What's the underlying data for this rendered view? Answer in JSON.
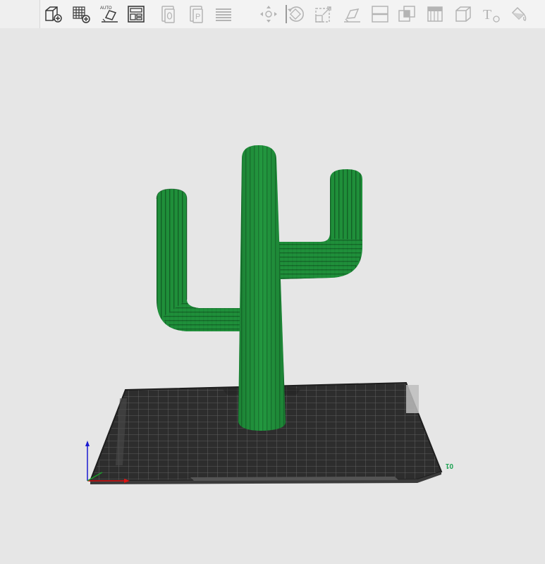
{
  "toolbar": {
    "buttons": [
      {
        "name": "add-object-button",
        "icon": "cube-plus-icon",
        "enabled": true
      },
      {
        "name": "add-plate-button",
        "icon": "grid-plus-icon",
        "enabled": true
      },
      {
        "name": "auto-orient-button",
        "icon": "auto-orient-icon",
        "label": "AUTO",
        "enabled": true
      },
      {
        "name": "arrange-button",
        "icon": "arrange-layout-icon",
        "enabled": true
      },
      {
        "name": "copy-button",
        "icon": "copy-icon",
        "enabled": false
      },
      {
        "name": "paste-button",
        "icon": "paste-icon",
        "label": "P",
        "enabled": false
      },
      {
        "name": "layers-button",
        "icon": "layers-icon",
        "enabled": false
      },
      {
        "name": "move-button",
        "icon": "move-arrows-icon",
        "enabled": false
      },
      {
        "name": "rotate-button",
        "icon": "rotate-icon",
        "enabled": false
      },
      {
        "name": "scale-button",
        "icon": "scale-icon",
        "enabled": false
      },
      {
        "name": "lay-on-face-button",
        "icon": "lay-on-face-icon",
        "enabled": false
      },
      {
        "name": "cut-button",
        "icon": "cut-icon",
        "enabled": false
      },
      {
        "name": "boolean-button",
        "icon": "boolean-icon",
        "enabled": false
      },
      {
        "name": "support-paint-button",
        "icon": "support-paint-icon",
        "enabled": false
      },
      {
        "name": "seam-paint-button",
        "icon": "seam-paint-icon",
        "enabled": false
      },
      {
        "name": "text-button",
        "icon": "text-tool-icon",
        "label": "T",
        "enabled": false
      },
      {
        "name": "color-paint-button",
        "icon": "paint-bucket-icon",
        "enabled": false
      }
    ],
    "colors": {
      "enabled": "#3a3a3a",
      "disabled": "#b4b4b4"
    }
  },
  "viewport": {
    "bed_number": "01",
    "model": {
      "name": "cactus",
      "color": "#1f8f3a"
    },
    "colors": {
      "background": "#e6e6e6",
      "bed": "#2d2d2d",
      "bed_grid": "#6a6a6a",
      "model": "#1f8f3a",
      "axis_x": "#d11",
      "axis_y": "#1a9c2a",
      "axis_z": "#1a1ad0"
    }
  }
}
